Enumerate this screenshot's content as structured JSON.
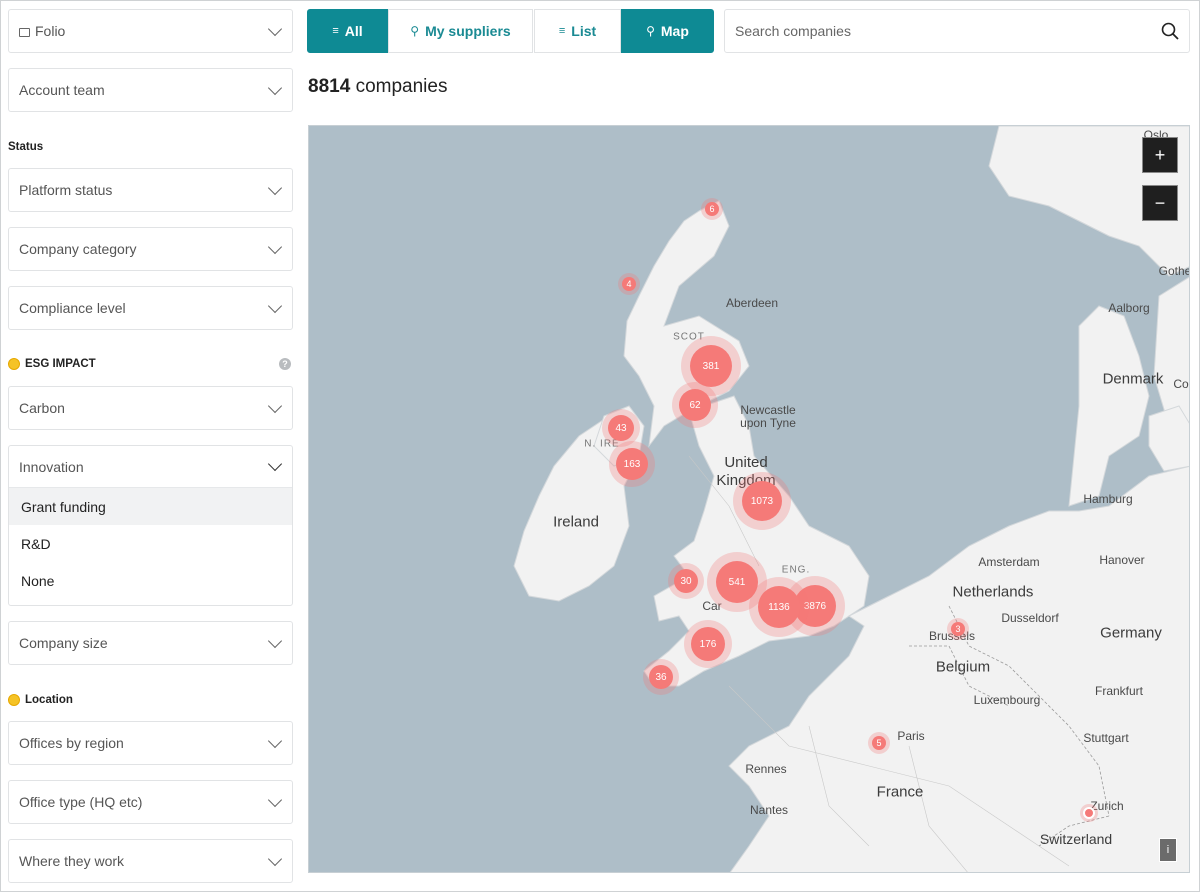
{
  "sidebar": {
    "folio_label": "Folio",
    "account_team_label": "Account team",
    "status_heading": "Status",
    "platform_status": "Platform status",
    "company_category": "Company category",
    "compliance_level": "Compliance level",
    "esg_heading": "ESG IMPACT",
    "carbon": "Carbon",
    "innovation": "Innovation",
    "innovation_options": [
      "Grant funding",
      "R&D",
      "None"
    ],
    "company_size": "Company size",
    "location_heading": "Location",
    "offices_by_region": "Offices by region",
    "office_type": "Office type (HQ etc)",
    "where_they_work": "Where they work"
  },
  "view_tabs": {
    "all": "All",
    "my_suppliers": "My suppliers",
    "list": "List",
    "map": "Map",
    "active": [
      "All",
      "Map"
    ]
  },
  "search": {
    "placeholder": "Search companies"
  },
  "results": {
    "count": "8814",
    "unit": "companies"
  },
  "map": {
    "zoom_in": "+",
    "zoom_out": "−",
    "info": "i",
    "countries": [
      "Ireland",
      "United Kingdom",
      "Denmark",
      "Netherlands",
      "Belgium",
      "Germany",
      "France",
      "Luxembourg",
      "Switzerland"
    ],
    "cities": [
      "Oslo",
      "Gothe",
      "Aalborg",
      "Co",
      "Aberdeen",
      "Newcastle upon Tyne",
      "Hamburg",
      "Amsterdam",
      "Hanover",
      "Dusseldorf",
      "Brussels",
      "Frankfurt",
      "Paris",
      "Stuttgart",
      "Rennes",
      "Nantes",
      "Zurich",
      "Car"
    ],
    "regions": [
      "SCOT",
      "N. IRE",
      "ENG."
    ],
    "clusters": [
      "6",
      "4",
      "381",
      "62",
      "43",
      "163",
      "1073",
      "30",
      "541",
      "1136",
      "3876",
      "176",
      "36",
      "3",
      "5"
    ]
  },
  "colors": {
    "accent": "#0e8a94",
    "cluster": "#f57a78",
    "water": "#aebec8",
    "land": "#f2f2f2"
  }
}
